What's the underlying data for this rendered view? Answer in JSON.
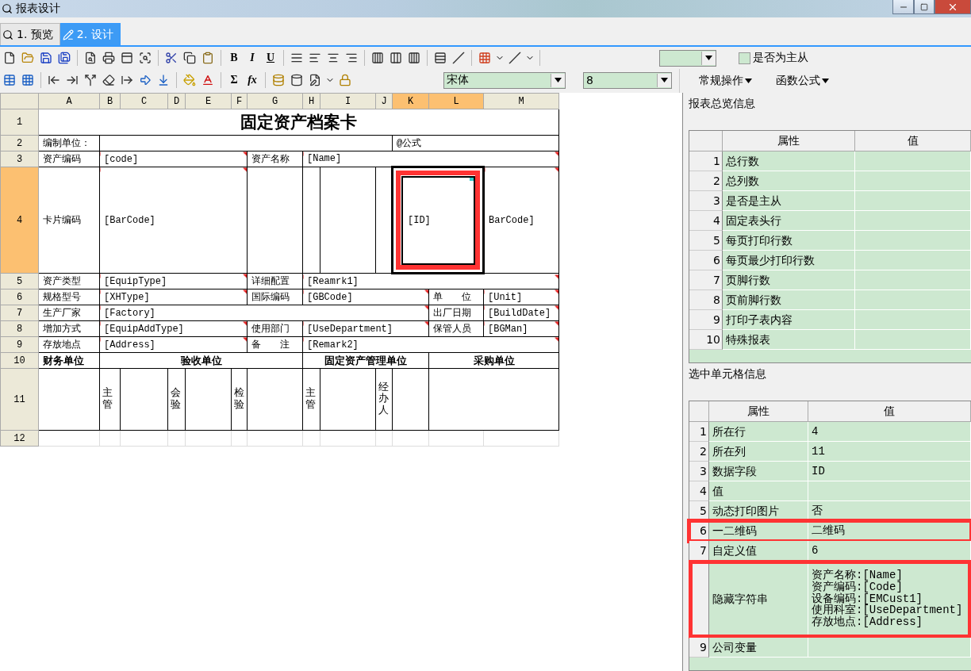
{
  "window": {
    "title": "报表设计"
  },
  "tabs": [
    {
      "label": "1. 预览",
      "selected": false
    },
    {
      "label": "2. 设计",
      "selected": true
    }
  ],
  "toolbar": {
    "format_buttons": [
      "B",
      "I",
      "U"
    ],
    "formula_buttons": [
      "Σ",
      "fx"
    ],
    "font": "宋体",
    "font_size": "8",
    "master_detail": {
      "label": "是否为主从",
      "checked": false
    }
  },
  "panel_menus": [
    "常规操作",
    "函数公式"
  ],
  "sheet": {
    "columns": [
      {
        "label": "A",
        "selected": false
      },
      {
        "label": "B",
        "selected": false
      },
      {
        "label": "C",
        "selected": false
      },
      {
        "label": "D",
        "selected": false
      },
      {
        "label": "E",
        "selected": false
      },
      {
        "label": "F",
        "selected": false
      },
      {
        "label": "G",
        "selected": false
      },
      {
        "label": "H",
        "selected": false
      },
      {
        "label": "I",
        "selected": false
      },
      {
        "label": "J",
        "selected": false
      },
      {
        "label": "K",
        "selected": true
      },
      {
        "label": "L",
        "selected": true
      },
      {
        "label": "M",
        "selected": false
      }
    ],
    "rows": [
      {
        "label": "1",
        "selected": false,
        "cells": [
          {
            "kind": "title",
            "text": "固定资产档案卡",
            "colspan": 13,
            "flag": false,
            "selected": false,
            "highlighted": false
          }
        ]
      },
      {
        "label": "2",
        "selected": false,
        "cells": [
          {
            "kind": "text",
            "text": "编制单位：",
            "flag": false,
            "selected": false,
            "highlighted": false
          },
          {
            "kind": "blank",
            "colspan": 9,
            "flag": false,
            "selected": false,
            "highlighted": false
          },
          {
            "kind": "text",
            "text": "@公式",
            "colspan": 3,
            "flag": false,
            "selected": false,
            "highlighted": false
          }
        ]
      },
      {
        "label": "3",
        "selected": false,
        "cells": [
          {
            "kind": "text",
            "text": "资产编码",
            "flag": false,
            "selected": false,
            "highlighted": false
          },
          {
            "kind": "text",
            "text": "[code]",
            "colspan": 5,
            "flag": true,
            "selected": false,
            "highlighted": false
          },
          {
            "kind": "text",
            "text": "资产名称",
            "flag": false,
            "selected": false,
            "highlighted": false
          },
          {
            "kind": "text",
            "text": "[Name]",
            "colspan": 6,
            "flag": true,
            "selected": false,
            "highlighted": false
          }
        ]
      },
      {
        "label": "4",
        "selected": true,
        "cells": [
          {
            "kind": "text",
            "text": "卡片编码",
            "flag": false,
            "selected": false,
            "highlighted": false
          },
          {
            "kind": "text",
            "text": "[BarCode]",
            "colspan": 5,
            "flag": true,
            "selected": false,
            "highlighted": false
          },
          {
            "kind": "blank",
            "flag": false,
            "selected": false,
            "highlighted": false
          },
          {
            "kind": "blank",
            "flag": false,
            "selected": false,
            "highlighted": false
          },
          {
            "kind": "blank",
            "flag": false,
            "selected": false,
            "highlighted": false
          },
          {
            "kind": "blank",
            "flag": false,
            "selected": false,
            "highlighted": false
          },
          {
            "kind": "text",
            "text": "[ID]",
            "colspan": 2,
            "flag": false,
            "selected": true,
            "highlighted": true
          },
          {
            "kind": "text",
            "text": "BarCode]",
            "flag": true,
            "selected": false,
            "highlighted": false
          }
        ]
      },
      {
        "label": "5",
        "selected": false,
        "cells": [
          {
            "kind": "text",
            "text": "资产类型",
            "flag": false,
            "selected": false,
            "highlighted": false
          },
          {
            "kind": "text",
            "text": "[EquipType]",
            "colspan": 5,
            "flag": true,
            "selected": false,
            "highlighted": false
          },
          {
            "kind": "text",
            "text": "详细配置",
            "flag": false,
            "selected": false,
            "highlighted": false
          },
          {
            "kind": "text",
            "text": "[Reamrk1]",
            "colspan": 6,
            "flag": true,
            "selected": false,
            "highlighted": false
          }
        ]
      },
      {
        "label": "6",
        "selected": false,
        "cells": [
          {
            "kind": "text",
            "text": "规格型号",
            "flag": false,
            "selected": false,
            "highlighted": false
          },
          {
            "kind": "text",
            "text": "[XHType]",
            "colspan": 5,
            "flag": true,
            "selected": false,
            "highlighted": false
          },
          {
            "kind": "text",
            "text": "国际编码",
            "flag": false,
            "selected": false,
            "highlighted": false
          },
          {
            "kind": "text",
            "text": "[GBCode]",
            "colspan": 4,
            "flag": true,
            "selected": false,
            "highlighted": false
          },
          {
            "kind": "text",
            "text": "单　　位",
            "flag": false,
            "selected": false,
            "highlighted": false
          },
          {
            "kind": "text",
            "text": "[Unit]",
            "flag": true,
            "selected": false,
            "highlighted": false
          }
        ]
      },
      {
        "label": "7",
        "selected": false,
        "cells": [
          {
            "kind": "text",
            "text": "生产厂家",
            "flag": false,
            "selected": false,
            "highlighted": false
          },
          {
            "kind": "text",
            "text": "[Factory]",
            "colspan": 10,
            "flag": true,
            "selected": false,
            "highlighted": false
          },
          {
            "kind": "text",
            "text": "出厂日期",
            "flag": false,
            "selected": false,
            "highlighted": false
          },
          {
            "kind": "text",
            "text": "[BuildDate]",
            "flag": true,
            "selected": false,
            "highlighted": false
          }
        ]
      },
      {
        "label": "8",
        "selected": false,
        "cells": [
          {
            "kind": "text",
            "text": "增加方式",
            "flag": false,
            "selected": false,
            "highlighted": false
          },
          {
            "kind": "text",
            "text": "[EquipAddType]",
            "colspan": 5,
            "flag": true,
            "selected": false,
            "highlighted": false
          },
          {
            "kind": "text",
            "text": "使用部门",
            "flag": false,
            "selected": false,
            "highlighted": false
          },
          {
            "kind": "text",
            "text": "[UseDepartment]",
            "colspan": 4,
            "flag": true,
            "selected": false,
            "highlighted": false
          },
          {
            "kind": "text",
            "text": "保管人员",
            "flag": false,
            "selected": false,
            "highlighted": false
          },
          {
            "kind": "text",
            "text": "[BGMan]",
            "flag": true,
            "selected": false,
            "highlighted": false
          }
        ]
      },
      {
        "label": "9",
        "selected": false,
        "cells": [
          {
            "kind": "text",
            "text": "存放地点",
            "flag": false,
            "selected": false,
            "highlighted": false
          },
          {
            "kind": "text",
            "text": "[Address]",
            "colspan": 5,
            "flag": true,
            "selected": false,
            "highlighted": false
          },
          {
            "kind": "text",
            "text": "备　　注",
            "flag": false,
            "selected": false,
            "highlighted": false
          },
          {
            "kind": "text",
            "text": "[Remark2]",
            "colspan": 6,
            "flag": true,
            "selected": false,
            "highlighted": false
          }
        ]
      },
      {
        "label": "10",
        "selected": false,
        "cells": [
          {
            "kind": "heading",
            "text": "财务单位",
            "flag": false,
            "selected": false,
            "highlighted": false
          },
          {
            "kind": "centered_heading",
            "text": "验收单位",
            "colspan": 6,
            "flag": false,
            "selected": false,
            "highlighted": false
          },
          {
            "kind": "centered_heading",
            "text": "固定资产管理单位",
            "colspan": 4,
            "flag": false,
            "selected": false,
            "highlighted": false
          },
          {
            "kind": "centered_heading",
            "text": "采购单位",
            "colspan": 2,
            "flag": false,
            "selected": false,
            "highlighted": false
          }
        ]
      },
      {
        "label": "11",
        "selected": false,
        "cells": [
          {
            "kind": "blank",
            "flag": false,
            "selected": false,
            "highlighted": false
          },
          {
            "kind": "vertical",
            "text": "主管",
            "flag": false,
            "selected": false,
            "highlighted": false
          },
          {
            "kind": "blank",
            "flag": false,
            "selected": false,
            "highlighted": false
          },
          {
            "kind": "vertical",
            "text": "会验",
            "flag": false,
            "selected": false,
            "highlighted": false
          },
          {
            "kind": "blank",
            "flag": false,
            "selected": false,
            "highlighted": false
          },
          {
            "kind": "vertical",
            "text": "检验",
            "flag": false,
            "selected": false,
            "highlighted": false
          },
          {
            "kind": "blank",
            "flag": false,
            "selected": false,
            "highlighted": false
          },
          {
            "kind": "vertical",
            "text": "主管",
            "flag": false,
            "selected": false,
            "highlighted": false
          },
          {
            "kind": "blank",
            "flag": false,
            "selected": false,
            "highlighted": false
          },
          {
            "kind": "vertical",
            "text": "经办人",
            "flag": false,
            "selected": false,
            "highlighted": false
          },
          {
            "kind": "blank",
            "flag": false,
            "selected": false,
            "highlighted": false
          },
          {
            "kind": "blank",
            "colspan": 2,
            "flag": false,
            "selected": false,
            "highlighted": false
          }
        ]
      },
      {
        "label": "12",
        "selected": false,
        "cells": [
          {
            "kind": "grid",
            "flag": false,
            "selected": false,
            "highlighted": false
          },
          {
            "kind": "grid",
            "flag": false,
            "selected": false,
            "highlighted": false
          },
          {
            "kind": "grid",
            "flag": false,
            "selected": false,
            "highlighted": false
          },
          {
            "kind": "grid",
            "flag": false,
            "selected": false,
            "highlighted": false
          },
          {
            "kind": "grid",
            "flag": false,
            "selected": false,
            "highlighted": false
          },
          {
            "kind": "grid",
            "flag": false,
            "selected": false,
            "highlighted": false
          },
          {
            "kind": "grid",
            "flag": false,
            "selected": false,
            "highlighted": false
          },
          {
            "kind": "grid",
            "flag": false,
            "selected": false,
            "highlighted": false
          },
          {
            "kind": "grid",
            "flag": false,
            "selected": false,
            "highlighted": false
          },
          {
            "kind": "grid",
            "flag": false,
            "selected": false,
            "highlighted": false
          },
          {
            "kind": "grid",
            "flag": false,
            "selected": false,
            "highlighted": false
          },
          {
            "kind": "grid",
            "flag": false,
            "selected": false,
            "highlighted": false
          },
          {
            "kind": "grid",
            "flag": false,
            "selected": false,
            "highlighted": false
          }
        ]
      }
    ]
  },
  "overview": {
    "title": "报表总览信息",
    "columns": [
      "属性",
      "值"
    ],
    "rows": [
      {
        "number": "1",
        "property": "总行数"
      },
      {
        "number": "2",
        "property": "总列数"
      },
      {
        "number": "3",
        "property": "是否是主从"
      },
      {
        "number": "4",
        "property": "固定表头行"
      },
      {
        "number": "5",
        "property": "每页打印行数"
      },
      {
        "number": "6",
        "property": "每页最少打印行数"
      },
      {
        "number": "7",
        "property": "页脚行数"
      },
      {
        "number": "8",
        "property": "页前脚行数"
      },
      {
        "number": "9",
        "property": "打印子表内容"
      },
      {
        "number": "10",
        "property": "特殊报表"
      }
    ]
  },
  "cell_info": {
    "title": "选中单元格信息",
    "columns": [
      "属性",
      "值"
    ],
    "rows": [
      {
        "number": "1",
        "property": "所在行",
        "value": "4",
        "highlighted": false
      },
      {
        "number": "2",
        "property": "所在列",
        "value": "11",
        "highlighted": false
      },
      {
        "number": "3",
        "property": "数据字段",
        "value": "ID",
        "highlighted": false
      },
      {
        "number": "4",
        "property": "值",
        "highlighted": false
      },
      {
        "number": "5",
        "property": "动态打印图片",
        "value": "否",
        "highlighted": false
      },
      {
        "number": "6",
        "property": "一二维码",
        "value": "二维码",
        "highlighted": true
      },
      {
        "number": "7",
        "property": "自定义值",
        "value": "6",
        "highlighted": false
      },
      {
        "property": "隐藏字符串",
        "value": "资产名称:[Name]\n资产编码:[Code]\n设备编码:[EMCust1]\n使用科室:[UseDepartment]\n存放地点:[Address]",
        "highlighted": true
      },
      {
        "number": "9",
        "property": "公司变量",
        "highlighted": false
      }
    ]
  }
}
